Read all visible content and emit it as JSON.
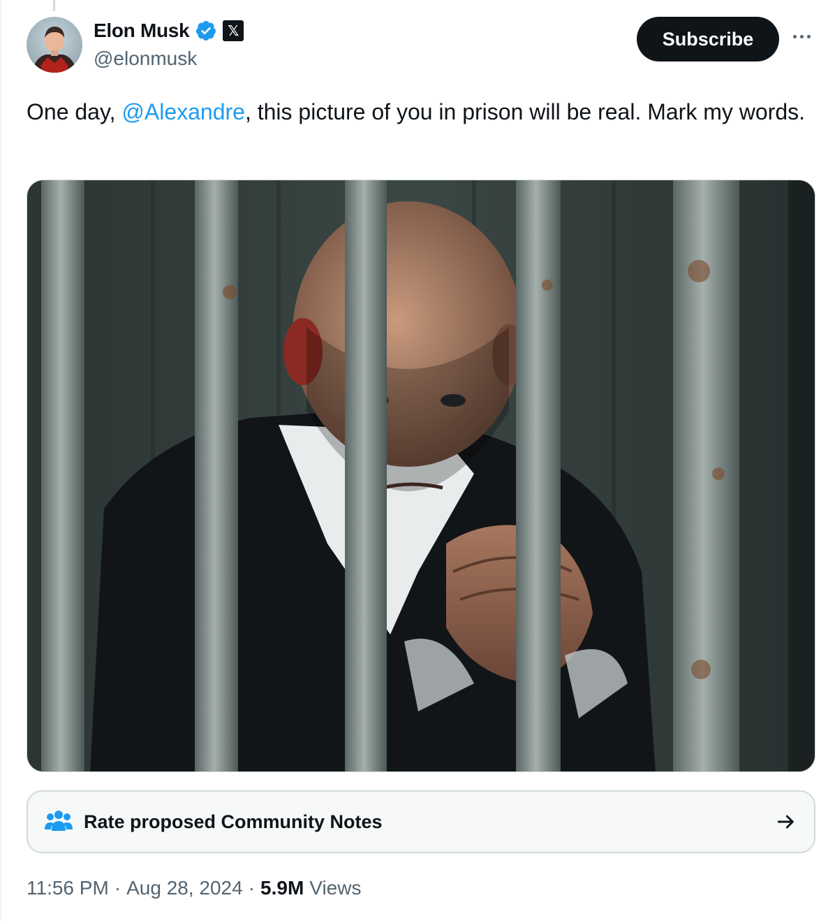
{
  "author": {
    "name": "Elon Musk",
    "handle": "@elonmusk",
    "verified_icon": "verified-badge-icon",
    "affiliation_icon": "x-logo-icon",
    "affiliation_glyph": "𝕏"
  },
  "actions": {
    "subscribe_label": "Subscribe",
    "more_icon": "more-horizontal-icon"
  },
  "tweet": {
    "text_before": "One day, ",
    "mention": "@Alexandre",
    "text_after": ", this picture of you in prison will be real. Mark my words."
  },
  "community_notes": {
    "label": "Rate proposed Community Notes",
    "icon": "people-icon",
    "arrow_icon": "arrow-right-icon"
  },
  "meta": {
    "time": "11:56 PM",
    "sep1": "·",
    "date": "Aug 28, 2024",
    "sep2": "·",
    "views_count": "5.9M",
    "views_label": "Views"
  },
  "colors": {
    "accent": "#1d9bf0",
    "text": "#0f1419",
    "secondary": "#536471",
    "border": "#cfd9de"
  }
}
